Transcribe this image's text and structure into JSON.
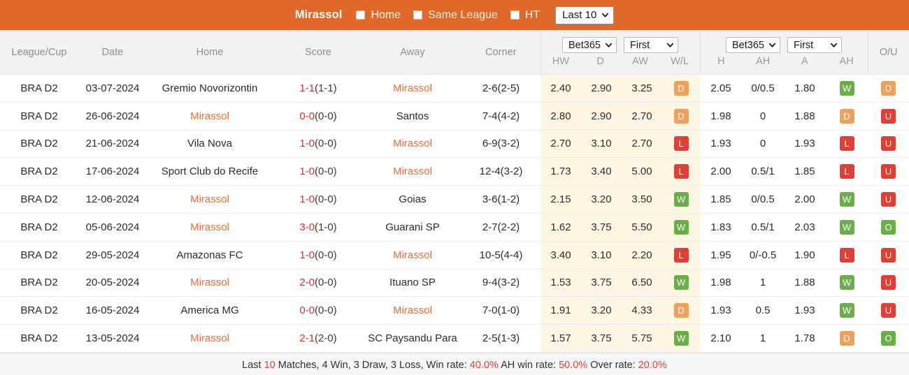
{
  "topbar": {
    "team": "Mirassol",
    "filters": [
      {
        "label": "Home",
        "checked": false
      },
      {
        "label": "Same League",
        "checked": false
      },
      {
        "label": "HT",
        "checked": false
      }
    ],
    "range_select": {
      "value": "Last 10",
      "icon": "chevron-down-icon"
    },
    "bg_color": "#e0682a"
  },
  "table": {
    "columns": {
      "league": "League/Cup",
      "date": "Date",
      "home": "Home",
      "score": "Score",
      "away": "Away",
      "corner": "Corner",
      "ou": "O/U"
    },
    "group1x2": {
      "bookmaker_select": "Bet365",
      "period_select": "First",
      "subcolumns": [
        "HW",
        "D",
        "AW",
        "W/L"
      ]
    },
    "group_ah": {
      "bookmaker_select": "Bet365",
      "period_select": "First",
      "subcolumns": [
        "H",
        "AH",
        "A",
        "AH"
      ]
    },
    "rows": [
      {
        "league": "BRA D2",
        "date": "03-07-2024",
        "home": "Gremio Novorizontin",
        "home_highlight": false,
        "score_main": "1-1",
        "score_ht": "(1-1)",
        "away": "Mirassol",
        "away_highlight": true,
        "corner": "2-6(2-5)",
        "hw": "2.40",
        "d": "2.90",
        "aw": "3.25",
        "wl": "D",
        "h": "2.05",
        "ah1": "0/0.5",
        "a": "1.80",
        "ah_result": "W",
        "ou": "D"
      },
      {
        "league": "BRA D2",
        "date": "26-06-2024",
        "home": "Mirassol",
        "home_highlight": true,
        "score_main": "0-0",
        "score_ht": "(0-0)",
        "away": "Santos",
        "away_highlight": false,
        "corner": "7-4(4-2)",
        "hw": "2.80",
        "d": "2.90",
        "aw": "2.70",
        "wl": "D",
        "h": "1.98",
        "ah1": "0",
        "a": "1.88",
        "ah_result": "D",
        "ou": "U"
      },
      {
        "league": "BRA D2",
        "date": "21-06-2024",
        "home": "Vila Nova",
        "home_highlight": false,
        "score_main": "1-0",
        "score_ht": "(0-0)",
        "away": "Mirassol",
        "away_highlight": true,
        "corner": "6-9(3-2)",
        "hw": "2.70",
        "d": "3.10",
        "aw": "2.70",
        "wl": "L",
        "h": "1.93",
        "ah1": "0",
        "a": "1.93",
        "ah_result": "L",
        "ou": "U"
      },
      {
        "league": "BRA D2",
        "date": "17-06-2024",
        "home": "Sport Club do Recife",
        "home_highlight": false,
        "score_main": "1-0",
        "score_ht": "(0-0)",
        "away": "Mirassol",
        "away_highlight": true,
        "corner": "12-4(3-2)",
        "hw": "1.73",
        "d": "3.40",
        "aw": "5.00",
        "wl": "L",
        "h": "2.00",
        "ah1": "0.5/1",
        "a": "1.85",
        "ah_result": "L",
        "ou": "U"
      },
      {
        "league": "BRA D2",
        "date": "12-06-2024",
        "home": "Mirassol",
        "home_highlight": true,
        "score_main": "1-0",
        "score_ht": "(0-0)",
        "away": "Goias",
        "away_highlight": false,
        "corner": "3-6(1-2)",
        "hw": "2.15",
        "d": "3.20",
        "aw": "3.50",
        "wl": "W",
        "h": "1.85",
        "ah1": "0/0.5",
        "a": "2.00",
        "ah_result": "W",
        "ou": "U"
      },
      {
        "league": "BRA D2",
        "date": "05-06-2024",
        "home": "Mirassol",
        "home_highlight": true,
        "score_main": "3-0",
        "score_ht": "(1-0)",
        "away": "Guarani SP",
        "away_highlight": false,
        "corner": "2-7(2-2)",
        "hw": "1.62",
        "d": "3.75",
        "aw": "5.50",
        "wl": "W",
        "h": "1.83",
        "ah1": "0.5/1",
        "a": "2.03",
        "ah_result": "W",
        "ou": "O"
      },
      {
        "league": "BRA D2",
        "date": "29-05-2024",
        "home": "Amazonas FC",
        "home_highlight": false,
        "score_main": "1-0",
        "score_ht": "(0-0)",
        "away": "Mirassol",
        "away_highlight": true,
        "corner": "10-5(4-4)",
        "hw": "3.40",
        "d": "3.10",
        "aw": "2.20",
        "wl": "L",
        "h": "1.95",
        "ah1": "0/-0.5",
        "a": "1.90",
        "ah_result": "L",
        "ou": "U"
      },
      {
        "league": "BRA D2",
        "date": "20-05-2024",
        "home": "Mirassol",
        "home_highlight": true,
        "score_main": "2-0",
        "score_ht": "(0-0)",
        "away": "Ituano SP",
        "away_highlight": false,
        "corner": "9-4(3-2)",
        "hw": "1.53",
        "d": "3.75",
        "aw": "6.50",
        "wl": "W",
        "h": "1.98",
        "ah1": "1",
        "a": "1.88",
        "ah_result": "W",
        "ou": "U"
      },
      {
        "league": "BRA D2",
        "date": "16-05-2024",
        "home": "America MG",
        "home_highlight": false,
        "score_main": "0-0",
        "score_ht": "(0-0)",
        "away": "Mirassol",
        "away_highlight": true,
        "corner": "7-0(1-0)",
        "hw": "1.91",
        "d": "3.20",
        "aw": "4.33",
        "wl": "D",
        "h": "1.93",
        "ah1": "0.5",
        "a": "1.93",
        "ah_result": "W",
        "ou": "U"
      },
      {
        "league": "BRA D2",
        "date": "13-05-2024",
        "home": "Mirassol",
        "home_highlight": true,
        "score_main": "2-1",
        "score_ht": "(2-0)",
        "away": "SC Paysandu Para",
        "away_highlight": false,
        "corner": "2-5(1-3)",
        "hw": "1.57",
        "d": "3.75",
        "aw": "5.75",
        "wl": "W",
        "h": "2.10",
        "ah1": "1",
        "a": "1.78",
        "ah_result": "D",
        "ou": "O"
      }
    ]
  },
  "footer": {
    "prefix": "Last ",
    "count": "10",
    "middle": " Matches, 4 Win, 3 Draw, 3 Loss, Win rate: ",
    "win_rate": "40.0%",
    "ah_label": " AH win rate: ",
    "ah_rate": "50.0%",
    "over_label": " Over rate: ",
    "over_rate": "20.0%"
  },
  "colors": {
    "header_orange": "#e0682a",
    "accent_team": "#ea6e3a",
    "score_red": "#d0342c",
    "badge_win": "#6aad4a",
    "badge_draw": "#eda15f",
    "badge_loss": "#dc4038",
    "shade_1x2": "#fdf7e3"
  }
}
